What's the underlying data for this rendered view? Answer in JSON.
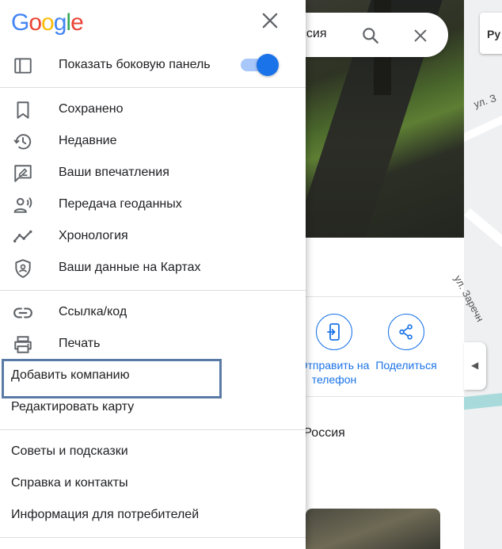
{
  "colors": {
    "accent": "#1a73e8",
    "toggle_track": "#a8c7fa",
    "focus": "#5a7aa6"
  },
  "search": {
    "query": "оссия"
  },
  "map": {
    "street_1": "ул. З",
    "street_2": "ул. Заречн",
    "chip": "Ру"
  },
  "place": {
    "actions": [
      {
        "icon": "send-to-phone-icon",
        "label": "Отправить на телефон"
      },
      {
        "icon": "share-icon",
        "label": "Поделиться"
      }
    ],
    "address": "., Россия"
  },
  "drawer": {
    "logo": {
      "letters": [
        "G",
        "o",
        "o",
        "g",
        "l",
        "e"
      ],
      "colors": [
        "#4285F4",
        "#EA4335",
        "#FBBC05",
        "#4285F4",
        "#34A853",
        "#EA4335"
      ]
    },
    "toggle_sidebar": {
      "label": "Показать боковую панель",
      "icon": "sidebar-icon",
      "on": true
    },
    "group1": [
      {
        "label": "Сохранено",
        "icon": "bookmark-icon"
      },
      {
        "label": "Недавние",
        "icon": "history-icon"
      },
      {
        "label": "Ваши впечатления",
        "icon": "review-icon"
      },
      {
        "label": "Передача геоданных",
        "icon": "location-sharing-icon"
      },
      {
        "label": "Хронология",
        "icon": "timeline-icon"
      },
      {
        "label": "Ваши данные на Картах",
        "icon": "shield-icon"
      }
    ],
    "group2": [
      {
        "label": "Ссылка/код",
        "icon": "link-icon"
      },
      {
        "label": "Печать",
        "icon": "print-icon"
      },
      {
        "label": "Добавить компанию"
      },
      {
        "label": "Редактировать карту"
      }
    ],
    "group3": [
      {
        "label": "Советы и подсказки"
      },
      {
        "label": "Справка и контакты"
      },
      {
        "label": "Информация для потребителей"
      }
    ]
  }
}
